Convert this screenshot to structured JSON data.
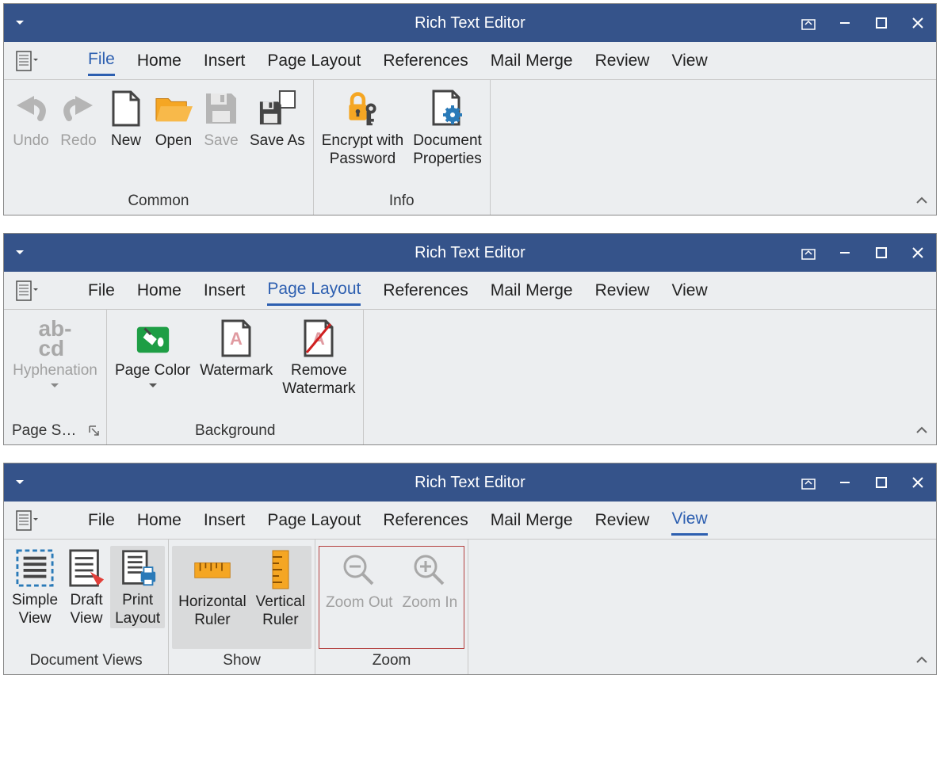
{
  "title": "Rich Text Editor",
  "tabs": [
    "File",
    "Home",
    "Insert",
    "Page Layout",
    "References",
    "Mail Merge",
    "Review",
    "View"
  ],
  "win1": {
    "g1": "Common",
    "g2": "Info",
    "undo": "Undo",
    "redo": "Redo",
    "new": "New",
    "open": "Open",
    "save": "Save",
    "saveas": "Save As",
    "encrypt1": "Encrypt with",
    "encrypt2": "Password",
    "docprop1": "Document",
    "docprop2": "Properties"
  },
  "win2": {
    "g1": "Page S…",
    "g2": "Background",
    "hyph": "Hyphenation",
    "pagecolor": "Page Color",
    "watermark": "Watermark",
    "rm1": "Remove",
    "rm2": "Watermark"
  },
  "win3": {
    "g1": "Document Views",
    "g2": "Show",
    "g3": "Zoom",
    "simple1": "Simple",
    "simple2": "View",
    "draft1": "Draft",
    "draft2": "View",
    "print1": "Print",
    "print2": "Layout",
    "hr1": "Horizontal",
    "hr2": "Ruler",
    "vr1": "Vertical",
    "vr2": "Ruler",
    "zoomout": "Zoom Out",
    "zoomin": "Zoom In"
  }
}
